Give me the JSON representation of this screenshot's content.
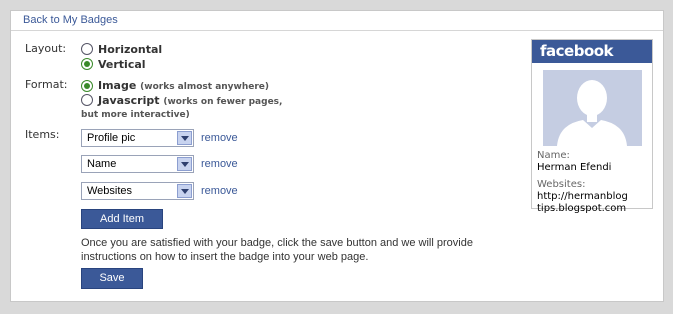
{
  "back_link": "Back to My Badges",
  "layout": {
    "label": "Layout:",
    "options": [
      {
        "label": "Horizontal",
        "selected": false
      },
      {
        "label": "Vertical",
        "selected": true
      }
    ]
  },
  "format": {
    "label": "Format:",
    "image_label": "Image",
    "image_hint": "(works almost anywhere)",
    "image_selected": true,
    "js_label": "Javascript",
    "js_hint_1": "(works on fewer pages,",
    "js_hint_2": "but more interactive)",
    "js_selected": false
  },
  "items": {
    "label": "Items:",
    "rows": [
      {
        "value": "Profile pic",
        "remove": "remove"
      },
      {
        "value": "Name",
        "remove": "remove"
      },
      {
        "value": "Websites",
        "remove": "remove"
      }
    ],
    "add_button": "Add Item"
  },
  "info_text": "Once you are satisfied with your badge, click the save button and we will provide instructions on how to insert the badge into your web page.",
  "save_button": "Save",
  "badge": {
    "logo": "facebook",
    "name_label": "Name:",
    "name_value": "Herman Efendi",
    "websites_label": "Websites:",
    "website_line1": "http://hermanblog",
    "website_line2": "tips.blogspot.com"
  },
  "colors": {
    "brand": "#3b5998",
    "radio_on": "#3a8a2a",
    "avatar_bg": "#c5cde2"
  }
}
